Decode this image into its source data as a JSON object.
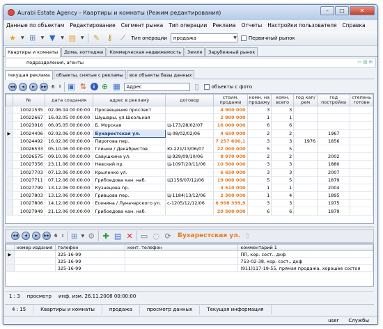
{
  "window": {
    "title": "Aurabi Estate Agency - Квартиры и комнаты (Режим редактирования)"
  },
  "menu": [
    "Данные по объектам",
    "Редактирование",
    "Сегмент рынка",
    "Тип операции",
    "Реклама",
    "Отчеты",
    "Настройки пользователя",
    "Справка"
  ],
  "toolbar": {
    "operation_label": "Тип операции",
    "operation_value": "продажа",
    "primary_market_label": "Первичный рынок"
  },
  "tabs_top": [
    "Квартиры и комнаты",
    "Дома, коттеджи",
    "Коммерческая недвижимость",
    "Земля",
    "Зарубежный рынок"
  ],
  "subbar": {
    "label": "подразделения, агенты"
  },
  "tabs_ads": [
    "текущая реклама",
    "объекты, снятые с рекламы",
    "все объекты базы данных"
  ],
  "navbar": {
    "count": "6",
    "field_label": "Адрес",
    "photo_label": "объекты с фото"
  },
  "grid": {
    "columns": [
      "№",
      "дата создания",
      "адрес в рекламу",
      "договор",
      "стоим. продажи",
      "комн. на продажу",
      "комн. всего",
      "год кап/рем",
      "год постройки",
      "степень готовн"
    ],
    "rows": [
      [
        "10021535",
        "02.06.04 00:00:00",
        "Просвещения проспект",
        "",
        "4 900 000",
        "3",
        "3",
        "",
        "",
        ""
      ],
      [
        "10022667",
        "16.02.05 00:00:00",
        "Шушары, ул.Школьная",
        "",
        "2 800 000",
        "1",
        "1",
        "",
        "",
        ""
      ],
      [
        "10023016",
        "06.05.05 00:00:00",
        "Б. Морская",
        "Ц-173/28/02/07",
        "16 000 000",
        "6",
        "6",
        "",
        "",
        ""
      ],
      [
        "10024406",
        "02.02.06 00:00:00",
        "Бухарестская ул.",
        "Ц-08/02/02/06",
        "4 650 000",
        "2",
        "2",
        "",
        "1967",
        ""
      ],
      [
        "10024492",
        "16.02.06 00:00:00",
        "Пирогова пер.",
        "",
        "7 257 600,1",
        "3",
        "3",
        "1976",
        "1856",
        ""
      ],
      [
        "10026533",
        "05.10.06 00:00:00",
        "Глинки / Декабристов",
        "Ю-221/13/06/07",
        "22 000 000",
        "5",
        "5",
        "",
        "",
        ""
      ],
      [
        "10026575",
        "09.10.06 00:00:00",
        "Савушкина ул.",
        "Ц-929/09/10/06",
        "8 970 000",
        "2",
        "2",
        "",
        "2002",
        ""
      ],
      [
        "10027356",
        "23.11.06 00:00:00",
        "Невский пр.",
        "Ц-1097/20/11/06",
        "10 500 000",
        "3",
        "3",
        "",
        "1880",
        ""
      ],
      [
        "10027703",
        "07.12.06 00:00:00",
        "Крыленко ул.",
        "",
        "6 650 000",
        "3",
        "3",
        "",
        "2007",
        ""
      ],
      [
        "10027711",
        "07.12.06 00:00:00",
        "Грибоедова кан. наб.",
        "Ц1156/07/12/06",
        "19 000 000",
        "5",
        "5",
        "",
        "1879",
        ""
      ],
      [
        "10027799",
        "13.12.06 00:00:00",
        "Кузнецова пр.",
        "",
        "3 510 000",
        "1",
        "1",
        "",
        "2004",
        ""
      ],
      [
        "10027803",
        "13.12.06 00:00:00",
        "Гривцова пер.",
        "Ц-1184/13/12/06",
        "2 300 000",
        "1",
        "4",
        "",
        "1895",
        ""
      ],
      [
        "10027806",
        "14.12.06 00:00:00",
        "Есенина / Луначарского ул.",
        "с-1205/12/12/06",
        "6 998 399,9",
        "3",
        "3",
        "",
        "1975",
        ""
      ],
      [
        "10027949",
        "21.12.06 00:00:00",
        "Грибоедова кан. наб.",
        "",
        "20 500 000",
        "6",
        "6",
        "",
        "1879",
        ""
      ]
    ]
  },
  "detail": {
    "count": "6",
    "title": "Бухарестская ул.",
    "columns": [
      "номер издания",
      "телефон",
      "конт. телефон",
      "комментарий 1"
    ],
    "rows": [
      [
        "",
        "325-16-99",
        "",
        "ПП, кор. сост., дкф"
      ],
      [
        "",
        "325-16-99",
        "",
        "753-02-38, кор. сост., дкф"
      ],
      [
        "",
        "325-16-99",
        "",
        "(911)117-19-55, прямая продажа, хорошее состоя"
      ]
    ]
  },
  "status": {
    "pos": "1 : 3",
    "mode": "просмотр",
    "changed": "инф. изм. 26.11.2008 00:00:00"
  },
  "status2": {
    "pos": "4 : 15",
    "section": "Квартиры и комнаты",
    "operation": "продажа",
    "view": "просмотр данных",
    "info": "Текущая информация"
  },
  "status3": {
    "user": "user",
    "services": "Службы"
  }
}
